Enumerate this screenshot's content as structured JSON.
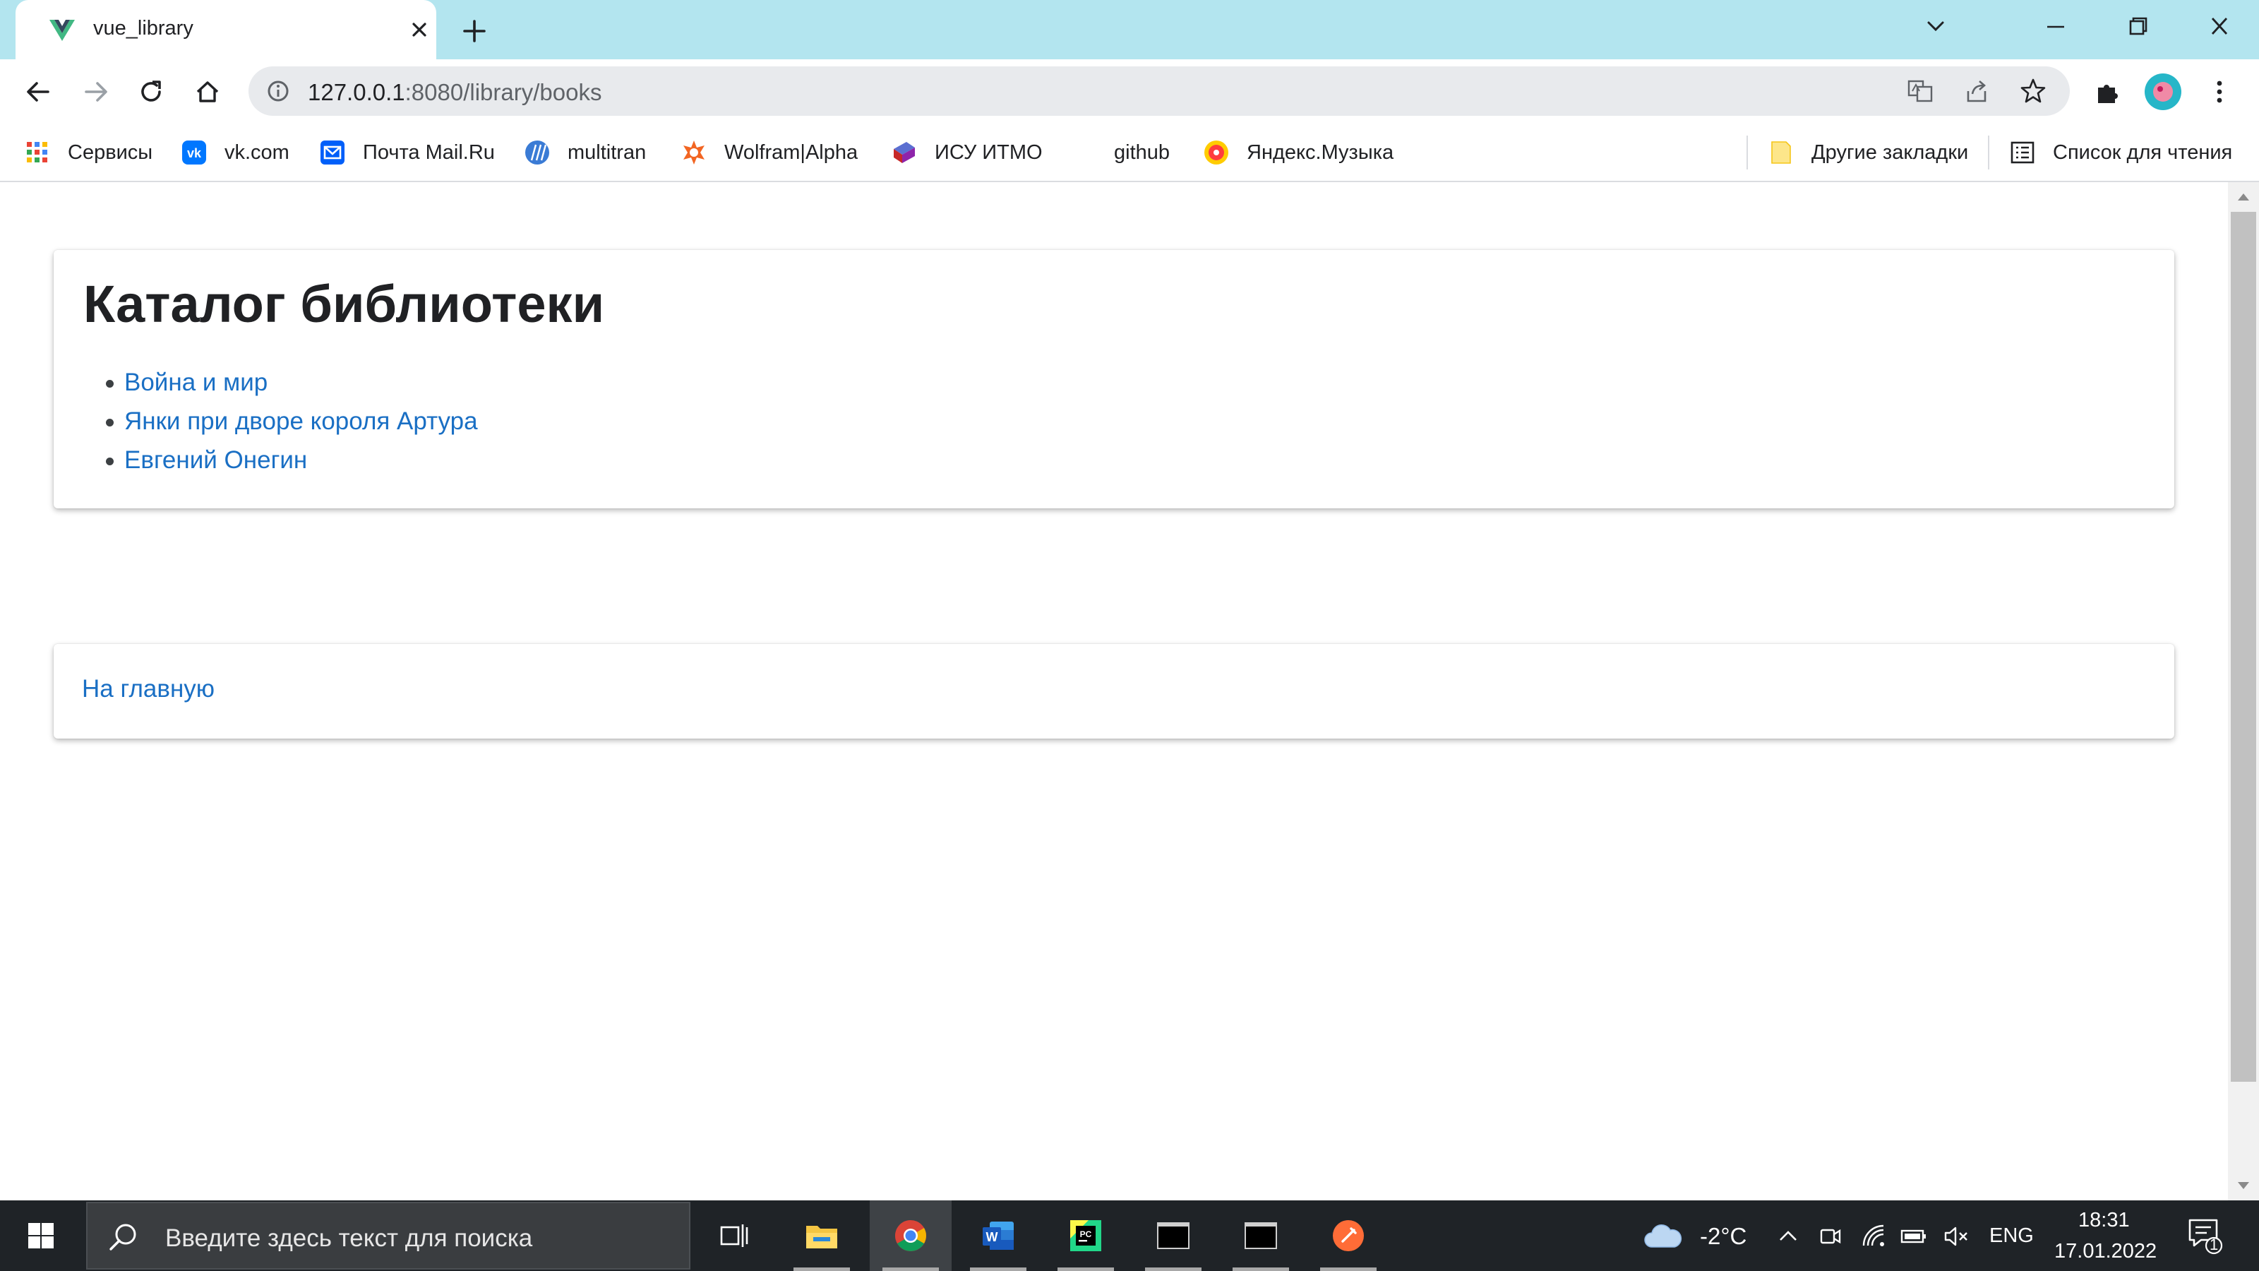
{
  "tab": {
    "title": "vue_library",
    "favicon": "vue-logo-icon"
  },
  "window_controls": [
    "chevron-down-icon",
    "minimize-icon",
    "restore-icon",
    "close-icon"
  ],
  "toolbar": {
    "url_host": "127.0.0.1",
    "url_rest": ":8080/library/books",
    "icons": [
      "back-icon",
      "forward-icon",
      "reload-icon",
      "home-icon",
      "info-icon",
      "translate-icon",
      "share-icon",
      "star-icon",
      "extensions-icon",
      "profile-avatar",
      "menu-icon"
    ]
  },
  "bookmarks": {
    "items": [
      {
        "label": "Сервисы",
        "icon": "apps-grid-icon"
      },
      {
        "label": "vk.com",
        "icon": "vk-icon"
      },
      {
        "label": "Почта Mail.Ru",
        "icon": "mail-icon"
      },
      {
        "label": "multitran",
        "icon": "multitran-icon"
      },
      {
        "label": "Wolfram|Alpha",
        "icon": "wolfram-icon"
      },
      {
        "label": "ИСУ ИТМО",
        "icon": "isu-icon"
      },
      {
        "label": "github",
        "icon": "github-icon"
      },
      {
        "label": "Яндекс.Музыка",
        "icon": "yandex-music-icon"
      }
    ],
    "other": {
      "label": "Другие закладки",
      "icon": "folder-icon"
    },
    "reading_list": {
      "label": "Список для чтения",
      "icon": "reading-list-icon"
    }
  },
  "page": {
    "title": "Каталог библиотеки",
    "books": [
      "Война и мир",
      "Янки при дворе короля Артура",
      "Евгений Онегин"
    ],
    "home_link": "На главную"
  },
  "taskbar": {
    "search_placeholder": "Введите здесь текст для поиска",
    "apps": [
      "task-view-icon",
      "file-explorer-icon",
      "chrome-icon",
      "word-icon",
      "pycharm-icon",
      "terminal-icon",
      "terminal-icon",
      "postman-icon"
    ],
    "weather": {
      "temperature": "-2°C",
      "icon": "cloud-icon"
    },
    "language": "ENG",
    "time": "18:31",
    "date": "17.01.2022",
    "notification_count": "1"
  },
  "colors": {
    "tab_strip": "#b3e5ef",
    "link": "#1a6fc4",
    "taskbar": "#1f2327"
  }
}
